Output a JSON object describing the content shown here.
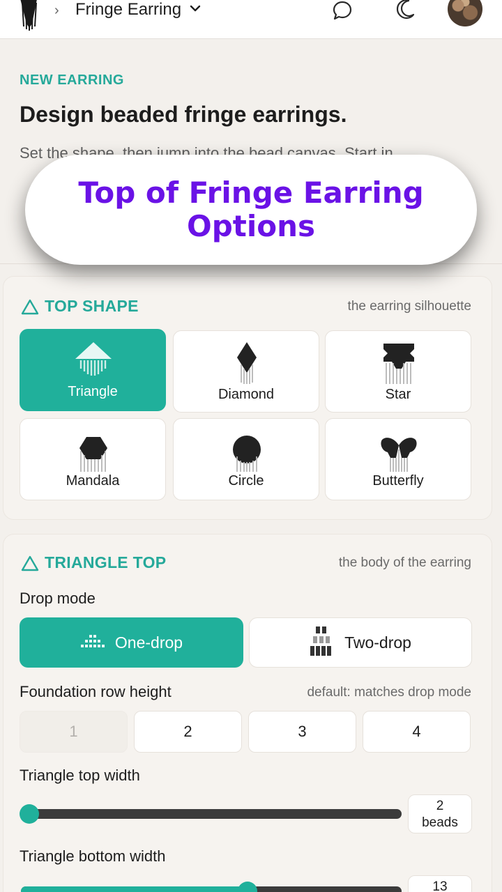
{
  "header": {
    "breadcrumb_sep": "›",
    "title": "Fringe Earring",
    "icons": [
      "fringe-logo-icon",
      "chevron-down-icon",
      "chat-bubble-icon",
      "moon-icon",
      "avatar"
    ]
  },
  "intro": {
    "eyebrow": "NEW EARRING",
    "heading": "Design beaded fringe earrings.",
    "text": "Set the shape, then jump into the bead canvas. Start in"
  },
  "overlay": {
    "text": "Top of Fringe Earring Options"
  },
  "top_shape": {
    "title": "TOP SHAPE",
    "subtitle": "the earring silhouette",
    "options": [
      {
        "label": "Triangle",
        "icon": "triangle-shape-icon",
        "selected": true
      },
      {
        "label": "Diamond",
        "icon": "diamond-shape-icon",
        "selected": false
      },
      {
        "label": "Star",
        "icon": "star-shape-icon",
        "selected": false
      },
      {
        "label": "Mandala",
        "icon": "mandala-shape-icon",
        "selected": false
      },
      {
        "label": "Circle",
        "icon": "circle-shape-icon",
        "selected": false
      },
      {
        "label": "Butterfly",
        "icon": "butterfly-shape-icon",
        "selected": false
      }
    ]
  },
  "triangle_top": {
    "title": "TRIANGLE TOP",
    "subtitle": "the body of the earring",
    "drop_mode": {
      "label": "Drop mode",
      "options": [
        {
          "label": "One-drop",
          "icon": "one-drop-icon",
          "selected": true
        },
        {
          "label": "Two-drop",
          "icon": "two-drop-icon",
          "selected": false
        }
      ]
    },
    "foundation": {
      "label": "Foundation row height",
      "hint": "default: matches drop mode",
      "options": [
        "1",
        "2",
        "3",
        "4"
      ],
      "disabled_option": "1"
    },
    "top_width": {
      "label": "Triangle top width",
      "value": "2",
      "unit": "beads",
      "fraction": 0.0
    },
    "bottom_width": {
      "label": "Triangle bottom width",
      "value": "13",
      "fraction": 0.6
    }
  },
  "colors": {
    "accent": "#20b09b",
    "accent_text": "#25a99a",
    "overlay_text": "#6a12e6",
    "track": "#3b3b3b"
  }
}
